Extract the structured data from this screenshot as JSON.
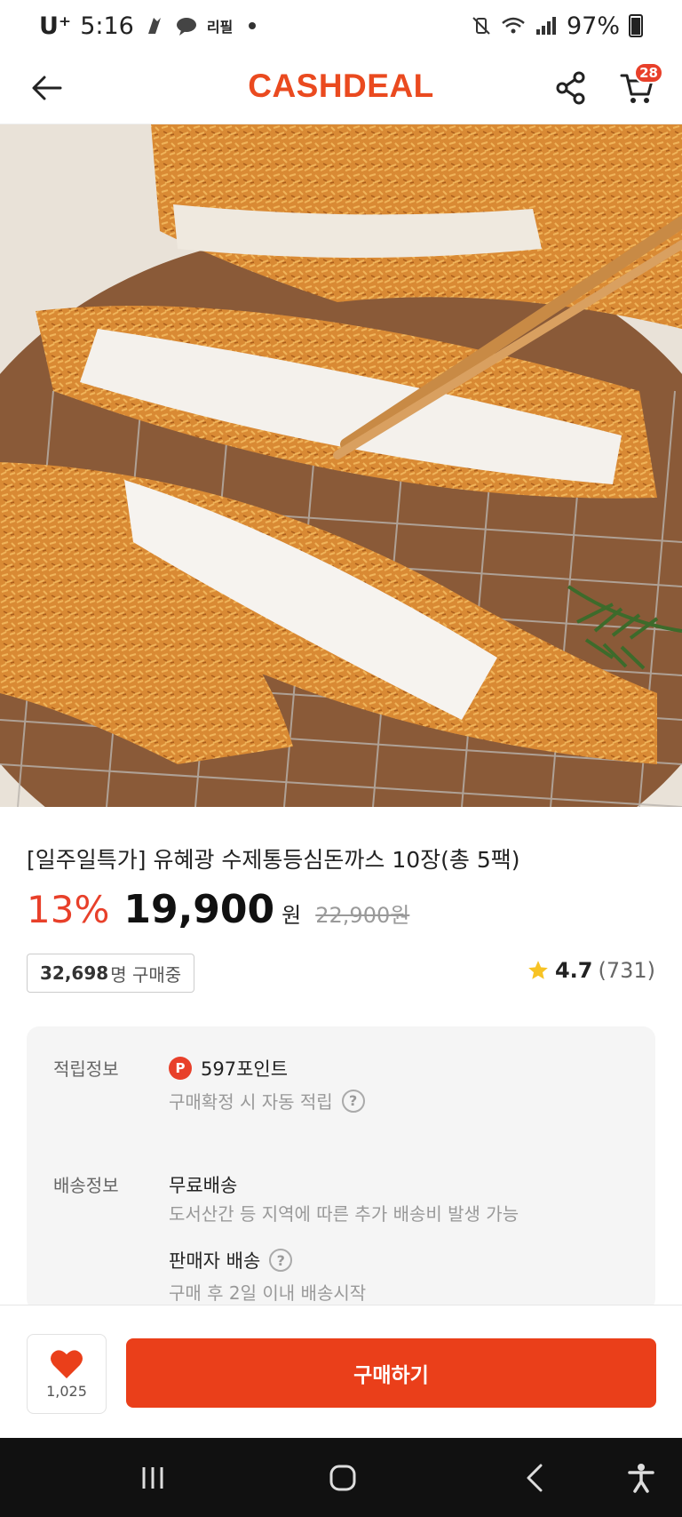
{
  "status_bar": {
    "carrier": "U⁺",
    "time": "5:16",
    "app_label": "리필",
    "battery": "97%"
  },
  "header": {
    "brand": "CASHDEAL",
    "cart_count": "28",
    "icons": [
      "back-arrow-icon",
      "share-icon",
      "cart-icon"
    ]
  },
  "product": {
    "title": "[일주일특가] 유혜광 수제통등심돈까스 10장(총 5팩)",
    "discount": "13%",
    "price": "19,900",
    "currency": "원",
    "original_price": "22,900원",
    "buyers_count": "32,698",
    "buyers_suffix": "명 구매중",
    "rating_score": "4.7",
    "rating_count": "(731)"
  },
  "info": {
    "points_label": "적립정보",
    "points_badge": "P",
    "points_value": "597포인트",
    "points_note": "구매확정 시 자동 적립",
    "delivery_label": "배송정보",
    "delivery_main": "무료배송",
    "delivery_note": "도서산간 등 지역에 따른 추가 배송비 발생 가능",
    "seller_delivery": "판매자 배송",
    "seller_delivery_note": "구매 후 2일 이내 배송시작"
  },
  "actions": {
    "like_count": "1,025",
    "buy_label": "구매하기"
  },
  "colors": {
    "brand": "#ea4a1f",
    "accent": "#e8402a"
  }
}
